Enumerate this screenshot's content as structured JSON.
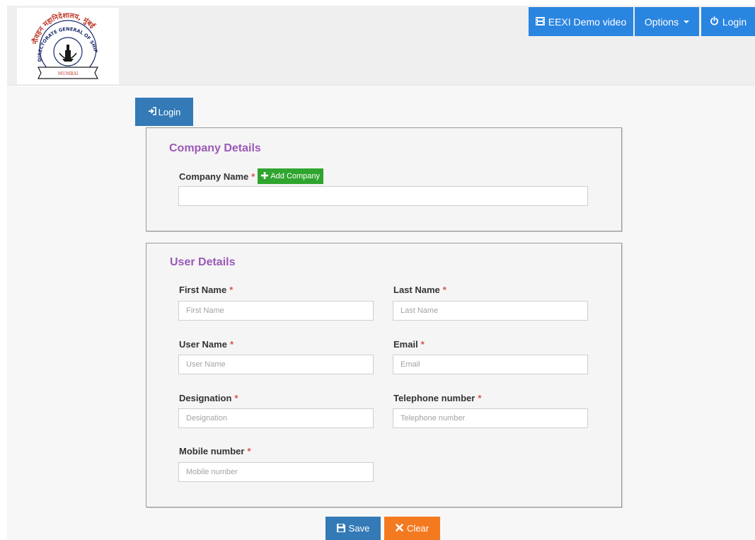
{
  "header": {
    "logo": {
      "arc_text": "नौवहन महानिदेशालय, मुंबई",
      "ring_text": "DIRECTORATE GENERAL OF SHIPPING",
      "ribbon_text": "MUMBAI"
    },
    "demo_label": "EEXI Demo video",
    "options_label": "Options",
    "login_label": "Login"
  },
  "tab": {
    "login_label": "Login"
  },
  "company": {
    "title": "Company Details",
    "name_label": "Company Name",
    "add_label": "Add Company",
    "name_value": ""
  },
  "user": {
    "title": "User Details",
    "first_name": {
      "label": "First Name",
      "placeholder": "First Name"
    },
    "last_name": {
      "label": "Last Name",
      "placeholder": "Last Name"
    },
    "user_name": {
      "label": "User Name",
      "placeholder": "User Name"
    },
    "email": {
      "label": "Email",
      "placeholder": "Email"
    },
    "designation": {
      "label": "Designation",
      "placeholder": "Designation"
    },
    "telephone": {
      "label": "Telephone number",
      "placeholder": "Telephone number"
    },
    "mobile": {
      "label": "Mobile number",
      "placeholder": "Mobile number"
    }
  },
  "required_marker": "*",
  "actions": {
    "save_label": "Save",
    "clear_label": "Clear"
  },
  "colors": {
    "nav_blue": "#2a85e0",
    "primary": "#337ab7",
    "section_title": "#9b59b6",
    "success": "#2fa52f",
    "warning": "#f47a20",
    "required": "#d9534f"
  }
}
